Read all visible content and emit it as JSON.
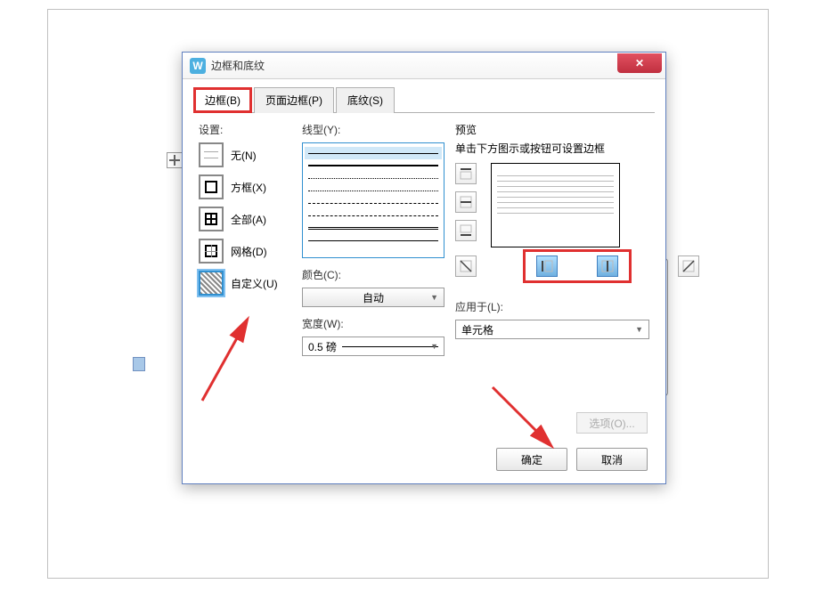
{
  "dialog": {
    "title": "边框和底纹",
    "tabs": {
      "border": "边框(B)",
      "page_border": "页面边框(P)",
      "shading": "底纹(S)"
    },
    "settings": {
      "label": "设置:",
      "none": "无(N)",
      "box": "方框(X)",
      "all": "全部(A)",
      "grid": "网格(D)",
      "custom": "自定义(U)"
    },
    "style": {
      "line_label": "线型(Y):",
      "color_label": "颜色(C):",
      "color_value": "自动",
      "width_label": "宽度(W):",
      "width_value": "0.5  磅"
    },
    "preview": {
      "label": "预览",
      "hint": "单击下方图示或按钮可设置边框"
    },
    "apply": {
      "label": "应用于(L):",
      "value": "单元格"
    },
    "options": "选项(O)...",
    "ok": "确定",
    "cancel": "取消"
  }
}
